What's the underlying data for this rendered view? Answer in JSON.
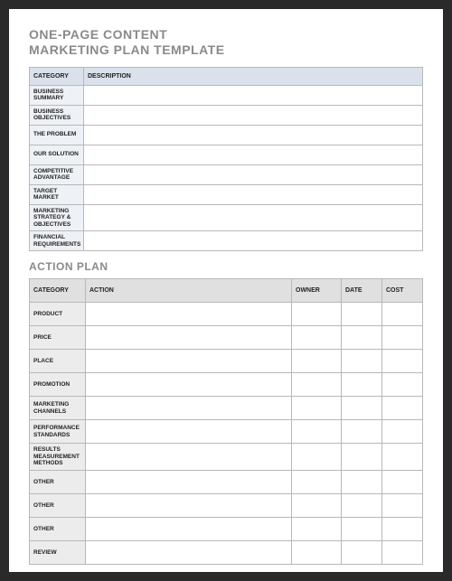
{
  "title_line1": "ONE-PAGE CONTENT",
  "title_line2": "MARKETING PLAN TEMPLATE",
  "table1": {
    "headers": {
      "category": "CATEGORY",
      "description": "DESCRIPTION"
    },
    "rows": [
      {
        "category": "BUSINESS SUMMARY",
        "description": ""
      },
      {
        "category": "BUSINESS OBJECTIVES",
        "description": ""
      },
      {
        "category": "THE PROBLEM",
        "description": ""
      },
      {
        "category": "OUR SOLUTION",
        "description": ""
      },
      {
        "category": "COMPETITIVE ADVANTAGE",
        "description": ""
      },
      {
        "category": "TARGET MARKET",
        "description": ""
      },
      {
        "category": "MARKETING STRATEGY & OBJECTIVES",
        "description": ""
      },
      {
        "category": "FINANCIAL REQUIREMENTS",
        "description": ""
      }
    ]
  },
  "section2_title": "ACTION PLAN",
  "table2": {
    "headers": {
      "category": "CATEGORY",
      "action": "ACTION",
      "owner": "OWNER",
      "date": "DATE",
      "cost": "COST"
    },
    "rows": [
      {
        "category": "PRODUCT",
        "action": "",
        "owner": "",
        "date": "",
        "cost": ""
      },
      {
        "category": "PRICE",
        "action": "",
        "owner": "",
        "date": "",
        "cost": ""
      },
      {
        "category": "PLACE",
        "action": "",
        "owner": "",
        "date": "",
        "cost": ""
      },
      {
        "category": "PROMOTION",
        "action": "",
        "owner": "",
        "date": "",
        "cost": ""
      },
      {
        "category": "MARKETING CHANNELS",
        "action": "",
        "owner": "",
        "date": "",
        "cost": ""
      },
      {
        "category": "PERFORMANCE STANDARDS",
        "action": "",
        "owner": "",
        "date": "",
        "cost": ""
      },
      {
        "category": "RESULTS MEASUREMENT METHODS",
        "action": "",
        "owner": "",
        "date": "",
        "cost": ""
      },
      {
        "category": "OTHER",
        "action": "",
        "owner": "",
        "date": "",
        "cost": ""
      },
      {
        "category": "OTHER",
        "action": "",
        "owner": "",
        "date": "",
        "cost": ""
      },
      {
        "category": "OTHER",
        "action": "",
        "owner": "",
        "date": "",
        "cost": ""
      },
      {
        "category": "REVIEW",
        "action": "",
        "owner": "",
        "date": "",
        "cost": ""
      }
    ]
  }
}
